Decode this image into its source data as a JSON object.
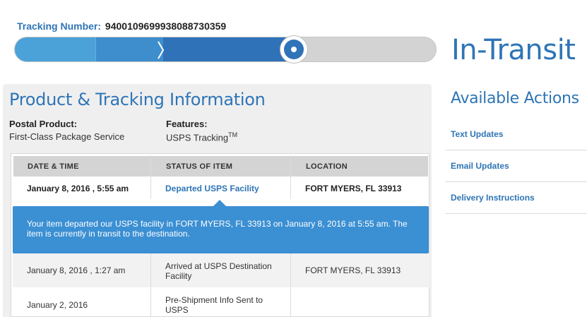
{
  "tracking": {
    "label": "Tracking Number:",
    "number": "9400109699938088730359",
    "status": "In-Transit",
    "progress_percent": 70
  },
  "product": {
    "title": "Product & Tracking Information",
    "postal_label": "Postal Product:",
    "postal_value": "First-Class Package Service",
    "features_label": "Features:",
    "features_value": "USPS Tracking",
    "features_mark": "TM"
  },
  "table": {
    "headers": [
      "DATE & TIME",
      "STATUS OF ITEM",
      "LOCATION"
    ],
    "rows": [
      {
        "date": "January 8, 2016 , 5:55 am",
        "status": "Departed USPS Facility",
        "location": "FORT MYERS, FL 33913"
      },
      {
        "date": "January 8, 2016 , 1:27 am",
        "status_line1": "Arrived at USPS Destination",
        "status_line2": "Facility",
        "location": "FORT MYERS, FL 33913"
      },
      {
        "date": "January 2, 2016",
        "status_line1": "Pre-Shipment Info Sent to",
        "status_line2": "USPS",
        "location": ""
      }
    ],
    "callout": "Your item departed our USPS facility in FORT MYERS, FL 33913 on January 8, 2016 at 5:55 am. The item is currently in transit to the destination."
  },
  "actions": {
    "title": "Available Actions",
    "items": [
      "Text Updates",
      "Email Updates",
      "Delivery Instructions"
    ]
  },
  "colors": {
    "accent": "#2e75b6",
    "callout": "#3b8fd3",
    "header_gray": "#d4d4d4"
  }
}
